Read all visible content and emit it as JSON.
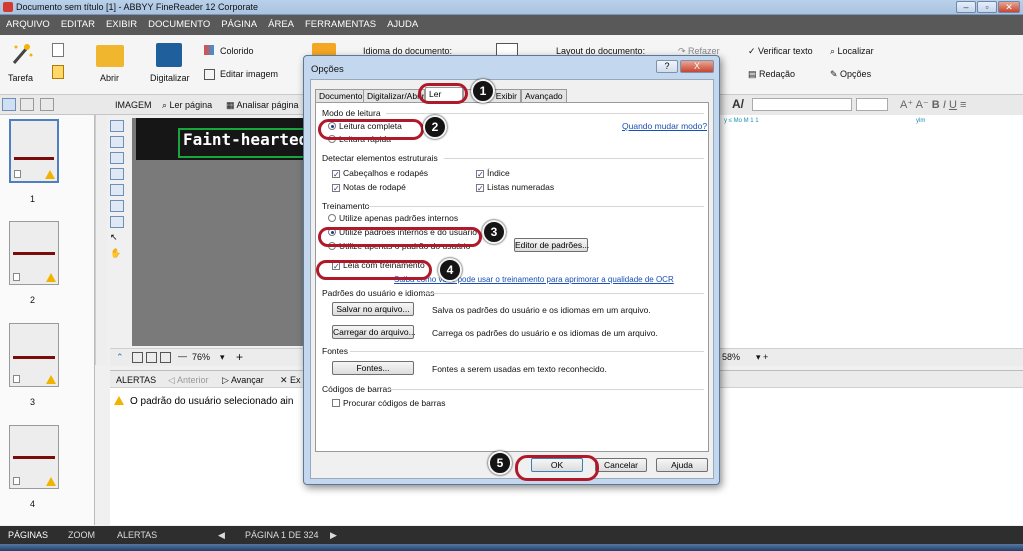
{
  "window": {
    "title": "Documento sem título [1] - ABBYY FineReader 12 Corporate"
  },
  "menu": [
    "ARQUIVO",
    "EDITAR",
    "EXIBIR",
    "DOCUMENTO",
    "PÁGINA",
    "ÁREA",
    "FERRAMENTAS",
    "AJUDA"
  ],
  "ribbon": {
    "tarefa": "Tarefa",
    "abrir": "Abrir",
    "digitalizar": "Digitalizar",
    "colorido": "Colorido",
    "editar_imagem": "Editar imagem",
    "idioma": "Idioma do documento:",
    "layout": "Layout do documento:",
    "refazer": "Refazer",
    "verificar": "Verificar texto",
    "localizar": "Localizar",
    "redacao": "Redação",
    "opcoes": "Opções"
  },
  "image_pane": {
    "label": "IMAGEM",
    "ler_pagina": "Ler página",
    "analisar": "Analisar página",
    "sample_text": "Faint-hearted t",
    "zoom": "76%",
    "text_zoom": "58%",
    "text_snippet_left": "y ≤ Mo M 1 1",
    "text_snippet_right": "ylm"
  },
  "pages": {
    "numbers": [
      "1",
      "2",
      "3",
      "4"
    ]
  },
  "alerts": {
    "label": "ALERTAS",
    "anterior": "Anterior",
    "avancar": "Avançar",
    "excluir": "Ex",
    "message": "O padrão do usuário selecionado ain"
  },
  "bottombar": {
    "paginas": "PÁGINAS",
    "zoom": "ZOOM",
    "alertas": "ALERTAS",
    "page_info": "PÁGINA 1 DE 324"
  },
  "dialog": {
    "title": "Opções",
    "help": "?",
    "close": "X",
    "tabs": [
      "Documento",
      "Digitalizar/Abrir",
      "Ler",
      "Exibir",
      "Avançado"
    ],
    "modo_leitura": "Modo de leitura",
    "leitura_completa": "Leitura completa",
    "leitura_rapida": "Leitura rápida",
    "quando_mudar": "Quando mudar modo?",
    "detectar": "Detectar elementos estruturais",
    "cabecalhos": "Cabeçalhos e rodapés",
    "indice": "Índice",
    "notas": "Notas de rodapé",
    "listas": "Listas numeradas",
    "treinamento": "Treinamento",
    "padroes_internos": "Utilize apenas padrões internos",
    "padroes_internos_usuario": "Utilize padrões internos e do usuário",
    "padrao_usuario": "Utilize apenas o padrão do usuário",
    "editor_padroes": "Editor de padrões...",
    "leia_treinamento": "Leia com treinamento",
    "saiba_link": "Saiba como você pode usar o treinamento para aprimorar a qualidade de OCR",
    "padroes_usuario_idiomas": "Padrões do usuário e idiomas",
    "salvar_arquivo": "Salvar no arquivo...",
    "salvar_desc": "Salva os padrões do usuário e os idiomas em um arquivo.",
    "carregar_arquivo": "Carregar do arquivo...",
    "carregar_desc": "Carrega os padrões do usuário e os idiomas de um arquivo.",
    "fontes": "Fontes",
    "fontes_btn": "Fontes...",
    "fontes_desc": "Fontes a serem usadas em texto reconhecido.",
    "codigos_barras": "Códigos de barras",
    "procurar_codigos": "Procurar códigos de barras",
    "ok": "OK",
    "cancelar": "Cancelar",
    "ajuda": "Ajuda"
  },
  "callouts": [
    "1",
    "2",
    "3",
    "4",
    "5"
  ],
  "colors": {
    "accent_red": "#b0192a",
    "menu_bg": "#595959",
    "link": "#1a4fb3"
  }
}
